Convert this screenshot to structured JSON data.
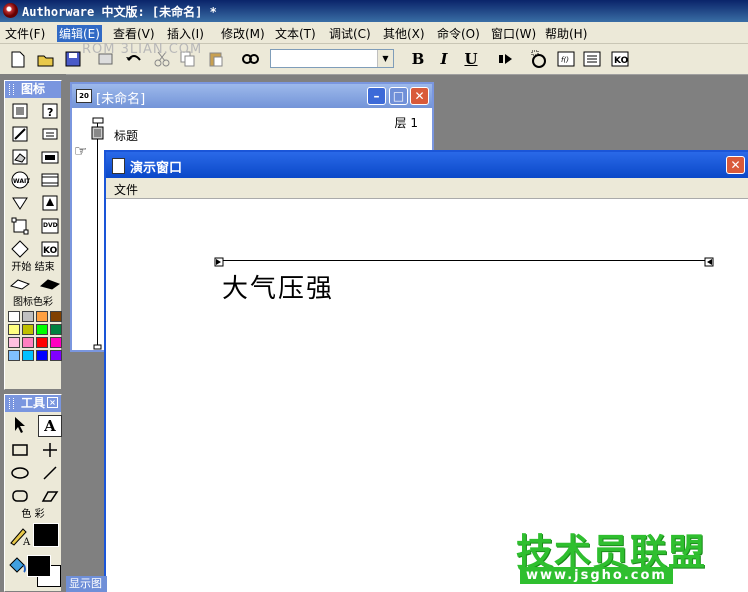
{
  "app": {
    "title": "Authorware 中文版: [未命名] *"
  },
  "menu": {
    "items": [
      "文件(F)",
      "编辑(E)",
      "查看(V)",
      "插入(I)",
      "修改(M)",
      "文本(T)",
      "调试(C)",
      "其他(X)",
      "命令(O)",
      "窗口(W)",
      "帮助(H)"
    ],
    "selected": "编辑(E)"
  },
  "toolbar": {
    "bold": "B",
    "italic": "I",
    "underline": "U",
    "font_combo_value": ""
  },
  "watermark_top": "ROM 3LIAN.COM",
  "icon_palette": {
    "title": "图标",
    "start": "开始",
    "end": "结束",
    "color_label": "图标色彩"
  },
  "tools_palette": {
    "title": "工具",
    "color_label": "色 彩"
  },
  "flow_window": {
    "title": "[未命名]",
    "layer": "层 1",
    "icon_label": "标题"
  },
  "presentation_window": {
    "title": "演示窗口",
    "menu_file": "文件",
    "text": "大气压强"
  },
  "bottom_tab": "显示图",
  "logo": {
    "cn": "技术员联盟",
    "url": "www.jsgho.com"
  },
  "colors": {
    "title_bar": "#0a246a",
    "xp_blue": "#0a48c8",
    "panel_bg": "#ece9d8",
    "logo_green": "#2fbf2f"
  }
}
